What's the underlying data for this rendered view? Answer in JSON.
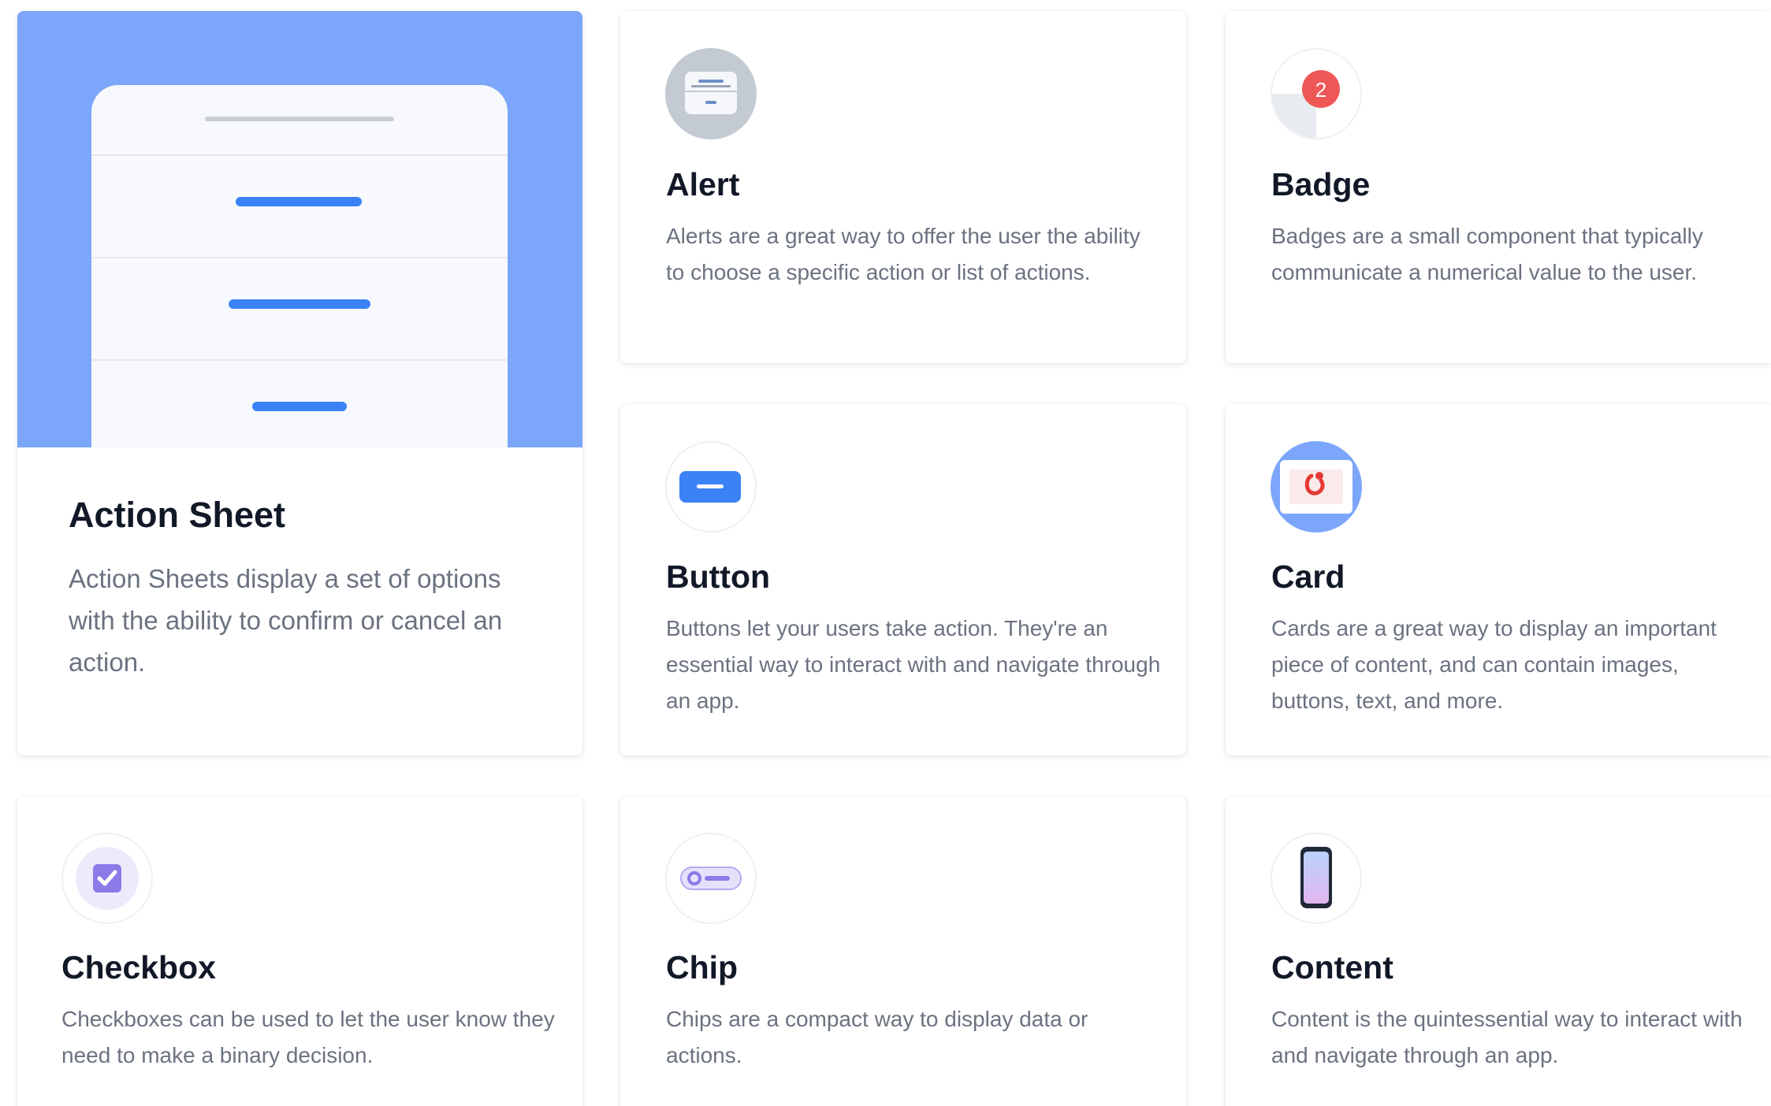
{
  "colors": {
    "hero_background": "#7ca6fa",
    "accent_blue": "#3b82f6",
    "badge_red": "#ef5757",
    "checkbox_purple": "#8b7ae8",
    "title_text": "#111827",
    "body_text": "#6b7280"
  },
  "cards": {
    "action_sheet": {
      "title": "Action Sheet",
      "description": "Action Sheets display a set of options with the ability to confirm or cancel an action.",
      "illustration": "action-sheet-mockup"
    },
    "alert": {
      "title": "Alert",
      "description": "Alerts are a great way to offer the user the ability to choose a specific action or list of actions.",
      "icon": "alert-icon"
    },
    "badge": {
      "title": "Badge",
      "description": "Badges are a small component that typically communicate a numerical value to the user.",
      "icon": "badge-icon",
      "badge_count": "2"
    },
    "button": {
      "title": "Button",
      "description": "Buttons let your users take action. They're an essential way to interact with and navigate through an app.",
      "icon": "button-icon"
    },
    "card": {
      "title": "Card",
      "description": "Cards are a great way to display an important piece of content, and can contain images, buttons, text, and more.",
      "icon": "card-icon"
    },
    "checkbox": {
      "title": "Checkbox",
      "description": "Checkboxes can be used to let the user know they need to make a binary decision.",
      "icon": "checkbox-icon"
    },
    "chip": {
      "title": "Chip",
      "description": "Chips are a compact way to display data or actions.",
      "icon": "chip-icon"
    },
    "content": {
      "title": "Content",
      "description": "Content is the quintessential way to interact with and navigate through an app.",
      "icon": "content-icon"
    }
  }
}
